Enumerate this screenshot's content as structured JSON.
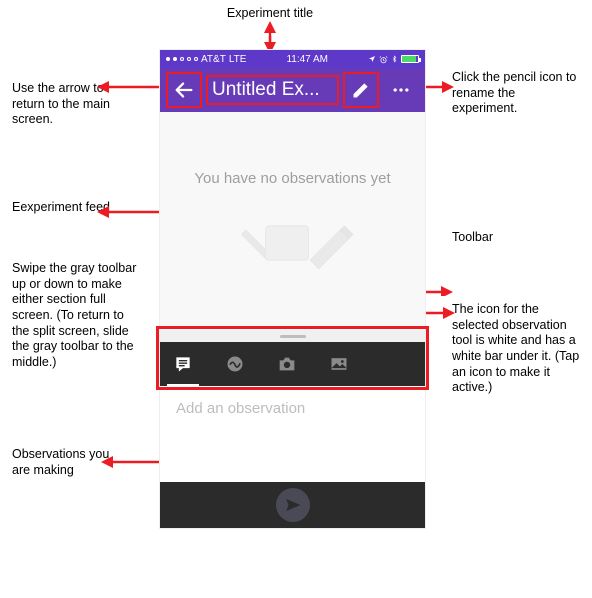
{
  "statusbar": {
    "carrier": "AT&T",
    "network": "LTE",
    "time": "11:47 AM",
    "battery_color": "#4cd964"
  },
  "appbar": {
    "title": "Untitled Ex...",
    "back_name": "back-arrow",
    "edit_name": "pencil",
    "overflow_name": "overflow"
  },
  "feed": {
    "empty_text": "You have no observations yet"
  },
  "toolbar": {
    "tools": [
      {
        "name": "note-icon",
        "active": true
      },
      {
        "name": "sensor-icon",
        "active": false
      },
      {
        "name": "camera-icon",
        "active": false
      },
      {
        "name": "gallery-icon",
        "active": false
      }
    ]
  },
  "observation_input": {
    "placeholder": "Add an observation"
  },
  "callouts": {
    "title": "Experiment title",
    "back": "Use the arrow to return to the main screen.",
    "pencil": "Click the pencil icon to rename the experiment.",
    "feed": "Eexperiment feed",
    "swipe": "Swipe the gray toolbar up or down to make either section full screen. (To return to the split screen, slide the gray toolbar to the middle.)",
    "toolbar": "Toolbar",
    "selected": "The icon for the selected observation tool is white and has a white bar under it. (Tap an icon to make it active.)",
    "obs": "Observations you are making"
  }
}
